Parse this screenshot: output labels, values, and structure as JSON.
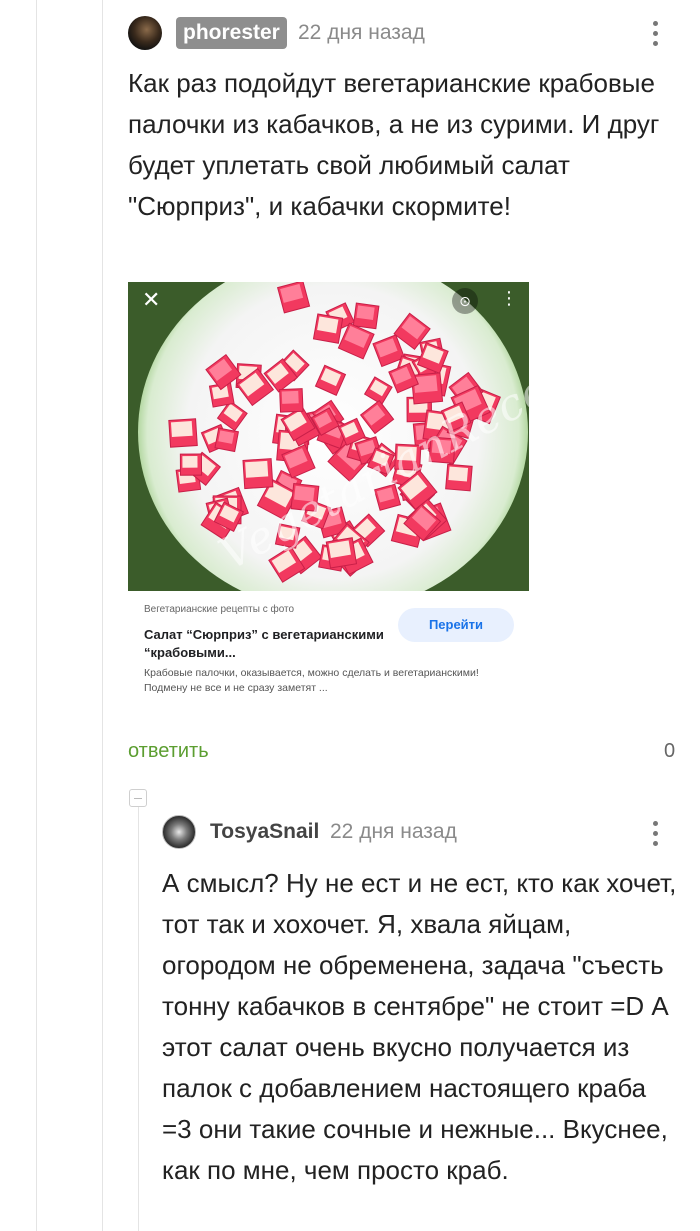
{
  "comment1": {
    "author": "phorester",
    "time": "22 дня назад",
    "text": "Как раз подойдут вегетарианские крабовые палочки из кабачков, а не из сурими. И друг будет уплетать свой любимый салат \"Сюрприз\", и кабачки скормите!",
    "image": {
      "watermark": "VegetarianRecepti",
      "source": "Вегетарианские рецепты с фото",
      "title": "Салат “Сюрприз” с вегетарианскими “крабовыми...",
      "description": "Крабовые палочки, оказывается, можно сделать и вегетарианскими! Подмену не все и не сразу заметят ...",
      "button": "Перейти",
      "close_icon": "✕",
      "lens_icon": "⊙",
      "more_icon": "⋮"
    },
    "reply_label": "ответить",
    "reply_count": "0"
  },
  "comment2": {
    "author": "TosyaSnail",
    "time": "22 дня назад",
    "text": "А смысл? Ну не ест и не ест, кто как хочет, тот так и хохочет. Я, хвала яйцам, огородом не обременена, задача \"съесть тонну кабачков в сентябре\" не стоит =D А этот салат очень вкусно получается из палок с добавлением настоящего краба =3 они такие сочные и нежные... Вкуснее, как по мне, чем просто краб."
  },
  "colors": {
    "accent_green": "#5c9e31",
    "badge_gray": "#8e8e8e",
    "link_blue": "#1a73e8"
  }
}
